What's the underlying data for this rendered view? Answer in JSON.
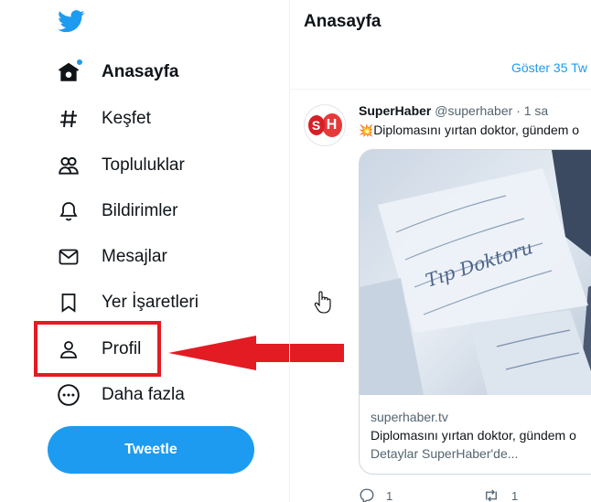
{
  "sidebar": {
    "items": [
      {
        "label": "Anasayfa",
        "icon": "home-icon",
        "active": true
      },
      {
        "label": "Keşfet",
        "icon": "hashtag-icon"
      },
      {
        "label": "Topluluklar",
        "icon": "communities-icon"
      },
      {
        "label": "Bildirimler",
        "icon": "bell-icon"
      },
      {
        "label": "Mesajlar",
        "icon": "envelope-icon"
      },
      {
        "label": "Yer İşaretleri",
        "icon": "bookmark-icon"
      },
      {
        "label": "Profil",
        "icon": "person-icon"
      },
      {
        "label": "Daha fazla",
        "icon": "more-circle-icon"
      }
    ],
    "tweet_button": "Tweetle"
  },
  "main": {
    "title": "Anasayfa",
    "show_more": "Göster 35 Tw",
    "tweet": {
      "author_name": "SuperHaber",
      "author_handle": "@superhaber",
      "separator": "·",
      "time": "1 sa",
      "avatar_letters": [
        "S",
        "H"
      ],
      "text": "Diplomasını yırtan doktor, gündem o",
      "emoji_icon": "collision-icon",
      "card": {
        "domain": "superhaber.tv",
        "title": "Diplomasını yırtan doktor, gündem o",
        "description": "Detaylar SuperHaber'de...",
        "image_text": "Tıp Doktoru"
      },
      "reply_count": "1",
      "retweet_count": "1"
    }
  },
  "colors": {
    "accent": "#1d9bf0",
    "highlight": "#e31b23",
    "text": "#0f1419",
    "muted": "#536471"
  }
}
